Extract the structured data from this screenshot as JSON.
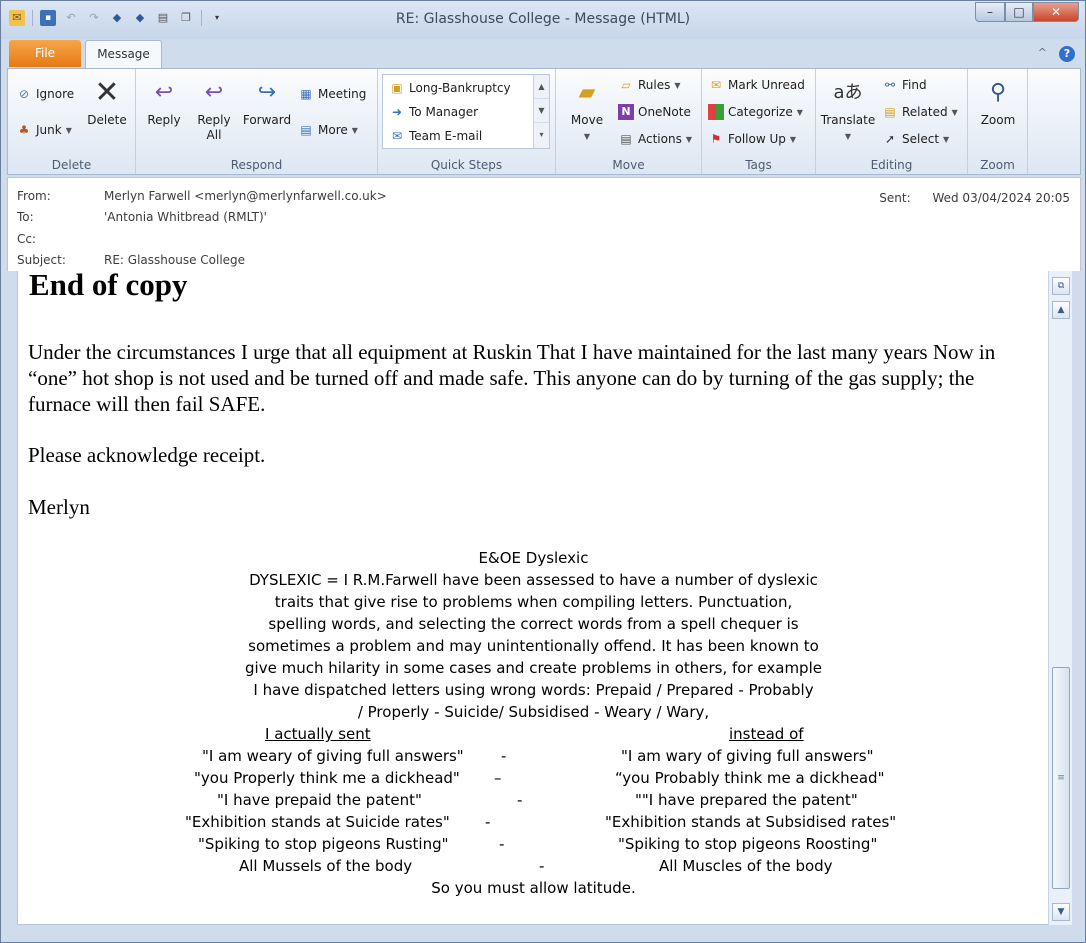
{
  "window": {
    "title": "RE: Glasshouse College",
    "title_suffix": "Message (HTML)",
    "title_sep": "-",
    "controls": {
      "minimize": "–",
      "maximize": "□",
      "close": "✕"
    }
  },
  "qat": {
    "items": [
      "mail-icon",
      "save-icon",
      "undo-icon",
      "redo-icon",
      "previous-icon",
      "next-icon",
      "print-icon",
      "copy-icon",
      "customize-icon"
    ]
  },
  "tabs": {
    "file": "File",
    "message": "Message",
    "collapse": "^",
    "help": "?"
  },
  "ribbon": {
    "delete": {
      "label": "Delete",
      "ignore": "Ignore",
      "junk": "Junk",
      "delete": "Delete"
    },
    "respond": {
      "label": "Respond",
      "reply": "Reply",
      "reply_all_1": "Reply",
      "reply_all_2": "All",
      "forward": "Forward",
      "meeting": "Meeting",
      "more": "More"
    },
    "quicksteps": {
      "label": "Quick Steps",
      "items": [
        "Long-Bankruptcy",
        "To Manager",
        "Team E-mail"
      ]
    },
    "move": {
      "label": "Move",
      "move": "Move",
      "rules": "Rules",
      "onenote": "OneNote",
      "actions": "Actions"
    },
    "tags": {
      "label": "Tags",
      "mark_unread": "Mark Unread",
      "categorize": "Categorize",
      "follow_up": "Follow Up"
    },
    "editing": {
      "label": "Editing",
      "translate": "Translate",
      "find": "Find",
      "related": "Related",
      "select": "Select"
    },
    "zoom": {
      "label": "Zoom",
      "zoom": "Zoom"
    }
  },
  "header": {
    "from_label": "From:",
    "from": "Merlyn Farwell <merlyn@merlynfarwell.co.uk>",
    "to_label": "To:",
    "to": "'Antonia Whitbread (RMLT)'",
    "cc_label": "Cc:",
    "cc": "",
    "subject_label": "Subject:",
    "subject": "RE: Glasshouse College",
    "sent_label": "Sent:",
    "sent": "Wed 03/04/2024 20:05"
  },
  "body": {
    "heading": "End of copy",
    "para1": "Under the circumstances I urge that all equipment at Ruskin That I have maintained for the last many years Now in “one” hot shop is not used and be turned off and made safe. This anyone can do by turning of the gas supply; the furnace will then fail SAFE.",
    "para2": "Please acknowledge receipt.",
    "signoff": "Merlyn",
    "sig_title": "E&OE Dyslexic",
    "sig_lines": [
      "DYSLEXIC = I R.M.Farwell have been assessed to have a number of dyslexic",
      "traits that give rise to problems when compiling letters. Punctuation,",
      "spelling words, and selecting the correct words from a spell chequer is",
      "sometimes a problem and may unintentionally offend. It has been known to",
      "give much hilarity in some cases and create problems in others, for example",
      "I have dispatched letters using wrong words: Prepaid / Prepared - Probably",
      "/ Properly - Suicide/ Subsidised - Weary / Wary,"
    ],
    "col_sent": "I actually sent",
    "col_instead": "instead of",
    "pairs": [
      {
        "sent": "\"I am weary of giving full answers\"",
        "dash": "-",
        "instead": "\"I am wary of giving full answers\""
      },
      {
        "sent": "\"you Properly think me a dickhead\"",
        "dash": "–",
        "instead": "“you Probably think me a dickhead\""
      },
      {
        "sent": "\"I have prepaid the patent\"",
        "dash": "-",
        "instead": "\"\"I have prepared the patent\""
      },
      {
        "sent": "\"Exhibition stands at Suicide rates\"",
        "dash": "-",
        "instead": "\"Exhibition stands at Subsidised rates\""
      },
      {
        "sent": "\"Spiking to stop pigeons Rusting\"",
        "dash": "-",
        "instead": "\"Spiking to stop pigeons Roosting\""
      },
      {
        "sent": "All Mussels of the body",
        "dash": "-",
        "instead": "All Muscles of the body"
      }
    ],
    "closing": "So you must allow latitude."
  },
  "scrollbar": {
    "up": "▲",
    "down": "▼",
    "grip": "≡"
  }
}
